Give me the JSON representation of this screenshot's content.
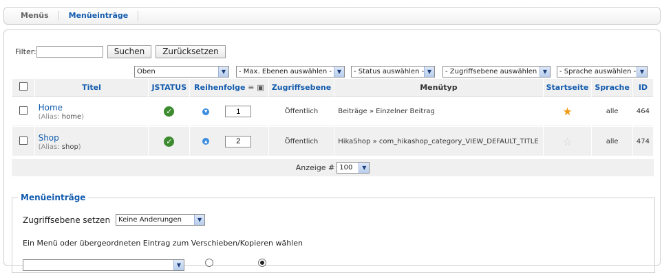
{
  "tabs": [
    {
      "label": "Menüs",
      "active": false
    },
    {
      "label": "Menüeinträge",
      "active": true
    }
  ],
  "filter": {
    "label": "Filter:",
    "value": "",
    "search_button": "Suchen",
    "reset_button": "Zurücksetzen"
  },
  "selects": {
    "menu": "Oben",
    "levels": "- Max. Ebenen auswählen -",
    "status": "- Status auswählen -",
    "access": "- Zugriffsebene auswählen -",
    "language": "- Sprache auswählen -"
  },
  "table": {
    "headers": {
      "title": "Titel",
      "status": "JSTATUS",
      "ordering": "Reihenfolge",
      "access": "Zugriffsebene",
      "menutype": "Menütyp",
      "home": "Startseite",
      "language": "Sprache",
      "id": "ID"
    },
    "rows": [
      {
        "title": "Home",
        "alias_prefix": "(Alias:",
        "alias": "home",
        "alias_suffix": ")",
        "order": "1",
        "access": "Öffentlich",
        "menutype": "Beiträge » Einzelner Beitrag",
        "home": true,
        "language": "alle",
        "id": "464"
      },
      {
        "title": "Shop",
        "alias_prefix": "(Alias:",
        "alias": "shop",
        "alias_suffix": ")",
        "order": "2",
        "access": "Öffentlich",
        "menutype": "HikaShop » com_hikashop_category_VIEW_DEFAULT_TITLE",
        "home": false,
        "language": "alle",
        "id": "474"
      }
    ]
  },
  "pager": {
    "label": "Anzeige #",
    "value": "100"
  },
  "batch": {
    "legend": "Menüeinträge",
    "access_label": "Zugriffsebene setzen",
    "access_value": "Keine Änderungen",
    "move_copy_label": "Ein Menü oder übergeordneten Eintrag zum Verschieben/Kopieren wählen"
  },
  "colors": {
    "link": "#135cae",
    "status_ok": "#3c8b2f",
    "star": "#f29b1b"
  }
}
